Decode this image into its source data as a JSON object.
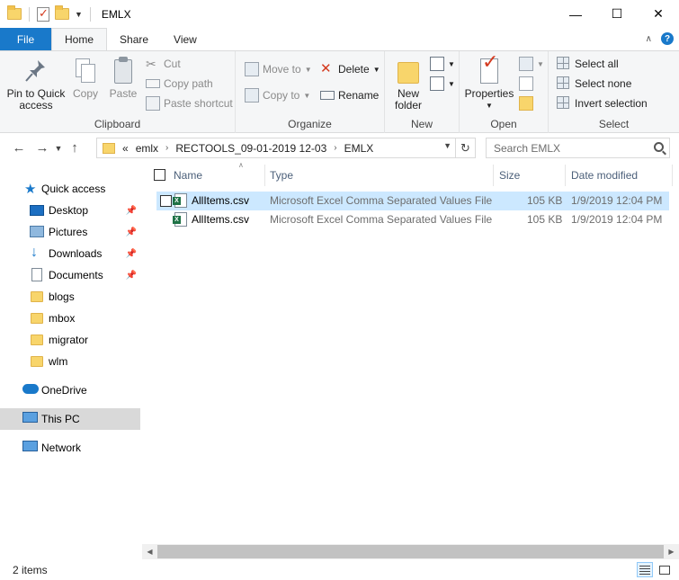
{
  "window": {
    "title": "EMLX",
    "controls": [
      "minimize",
      "maximize",
      "close"
    ]
  },
  "quick_access_toolbar": {
    "icons": [
      "folder-icon",
      "properties-icon",
      "new-folder-icon",
      "customize-dropdown-icon"
    ]
  },
  "ribbon_tabs": {
    "file": "File",
    "home": "Home",
    "share": "Share",
    "view": "View",
    "active": "Home"
  },
  "ribbon": {
    "clipboard": {
      "label": "Clipboard",
      "pin_label_1": "Pin to Quick",
      "pin_label_2": "access",
      "copy": "Copy",
      "paste": "Paste",
      "cut": "Cut",
      "copy_path": "Copy path",
      "paste_shortcut": "Paste shortcut"
    },
    "organize": {
      "label": "Organize",
      "move_to": "Move to",
      "copy_to": "Copy to",
      "delete": "Delete",
      "rename": "Rename"
    },
    "new": {
      "label": "New",
      "new_folder_1": "New",
      "new_folder_2": "folder"
    },
    "open": {
      "label": "Open",
      "properties": "Properties"
    },
    "select": {
      "label": "Select",
      "select_all": "Select all",
      "select_none": "Select none",
      "invert_selection": "Invert selection"
    }
  },
  "address_bar": {
    "overflow": "«",
    "crumbs": [
      "emlx",
      "RECTOOLS_09-01-2019 12-03",
      "EMLX"
    ]
  },
  "search": {
    "placeholder": "Search EMLX"
  },
  "nav_pane": {
    "quick_access": "Quick access",
    "items": [
      {
        "label": "Desktop",
        "pinned": true
      },
      {
        "label": "Pictures",
        "pinned": true
      },
      {
        "label": "Downloads",
        "pinned": true
      },
      {
        "label": "Documents",
        "pinned": true
      },
      {
        "label": "blogs",
        "pinned": false
      },
      {
        "label": "mbox",
        "pinned": false
      },
      {
        "label": "migrator",
        "pinned": false
      },
      {
        "label": "wlm",
        "pinned": false
      }
    ],
    "onedrive": "OneDrive",
    "this_pc": "This PC",
    "network": "Network",
    "selected": "This PC"
  },
  "file_list": {
    "columns": [
      "Name",
      "Type",
      "Size",
      "Date modified"
    ],
    "sort_column": "Name",
    "rows": [
      {
        "name": "AllItems.csv",
        "type": "Microsoft Excel Comma Separated Values File",
        "size": "105 KB",
        "date": "1/9/2019 12:04 PM",
        "selected": true
      },
      {
        "name": "AllItems.csv",
        "type": "Microsoft Excel Comma Separated Values File",
        "size": "105 KB",
        "date": "1/9/2019 12:04 PM",
        "selected": false
      }
    ]
  },
  "status_bar": {
    "item_count": "2 items",
    "view_mode": "details"
  },
  "colors": {
    "accent": "#1979ca",
    "selection": "#cce8ff",
    "ribbon_bg": "#f5f6f7"
  }
}
